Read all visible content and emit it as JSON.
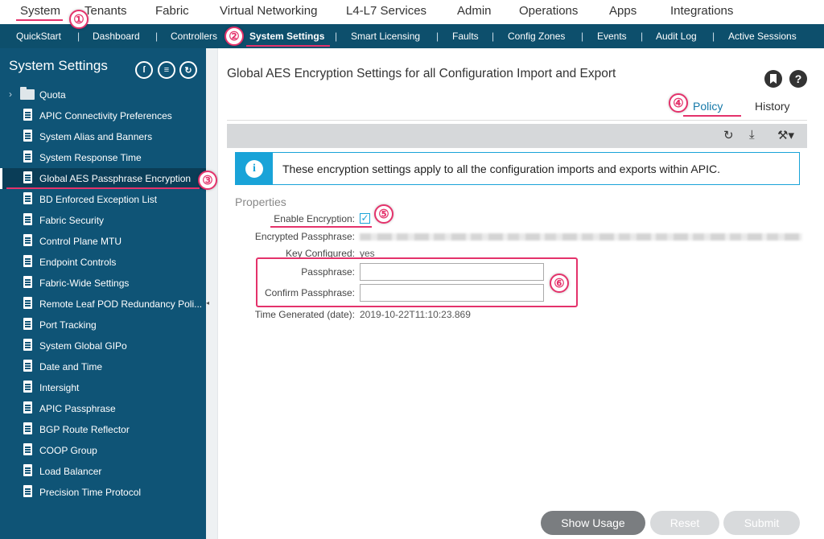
{
  "top_nav": [
    "System",
    "Tenants",
    "Fabric",
    "Virtual Networking",
    "L4-L7 Services",
    "Admin",
    "Operations",
    "Apps",
    "Integrations"
  ],
  "sub_nav": [
    "QuickStart",
    "Dashboard",
    "Controllers",
    "System Settings",
    "Smart Licensing",
    "Faults",
    "Config Zones",
    "Events",
    "Audit Log",
    "Active Sessions"
  ],
  "sidebar": {
    "title": "System Settings",
    "items": [
      "Quota",
      "APIC Connectivity Preferences",
      "System Alias and Banners",
      "System Response Time",
      "Global AES Passphrase Encryption",
      "BD Enforced Exception List",
      "Fabric Security",
      "Control Plane MTU",
      "Endpoint Controls",
      "Fabric-Wide Settings",
      "Remote Leaf POD Redundancy Poli...",
      "Port Tracking",
      "System Global GIPo",
      "Date and Time",
      "Intersight",
      "APIC Passphrase",
      "BGP Route Reflector",
      "COOP Group",
      "Load Balancer",
      "Precision Time Protocol"
    ],
    "active_item": "Global AES Passphrase Encryption"
  },
  "main": {
    "title": "Global AES Encryption Settings for all Configuration Import and Export",
    "tabs": [
      "Policy",
      "History"
    ],
    "active_tab": "Policy",
    "info_text": "These encryption settings apply to all the configuration imports and exports within APIC.",
    "properties_heading": "Properties",
    "fields": {
      "enable_encryption_label": "Enable Encryption:",
      "enable_encryption_checked": true,
      "encrypted_passphrase_label": "Encrypted Passphrase:",
      "key_configured_label": "Key Configured:",
      "key_configured_value": "yes",
      "passphrase_label": "Passphrase:",
      "passphrase_value": "",
      "confirm_passphrase_label": "Confirm Passphrase:",
      "confirm_passphrase_value": "",
      "time_generated_label": "Time Generated (date):",
      "time_generated_value": "2019-10-22T11:10:23.869"
    },
    "buttons": [
      "Show Usage",
      "Reset",
      "Submit"
    ]
  },
  "annotations": [
    "①",
    "②",
    "③",
    "④",
    "⑤",
    "⑥"
  ],
  "icons": {
    "toolbar": [
      "refresh-icon",
      "download-icon",
      "tools-icon"
    ],
    "header": [
      "bookmark-icon",
      "help-icon"
    ],
    "sidebar_header": [
      "filter-icon",
      "list-icon",
      "refresh-icon"
    ]
  },
  "colors": {
    "nav_bg": "#0d4f6c",
    "sidebar_bg": "#0f5476",
    "accent": "#19a3d8",
    "annotation": "#e4326b",
    "primary_button": "#7a7d80",
    "disabled_button": "#d8dadc"
  }
}
